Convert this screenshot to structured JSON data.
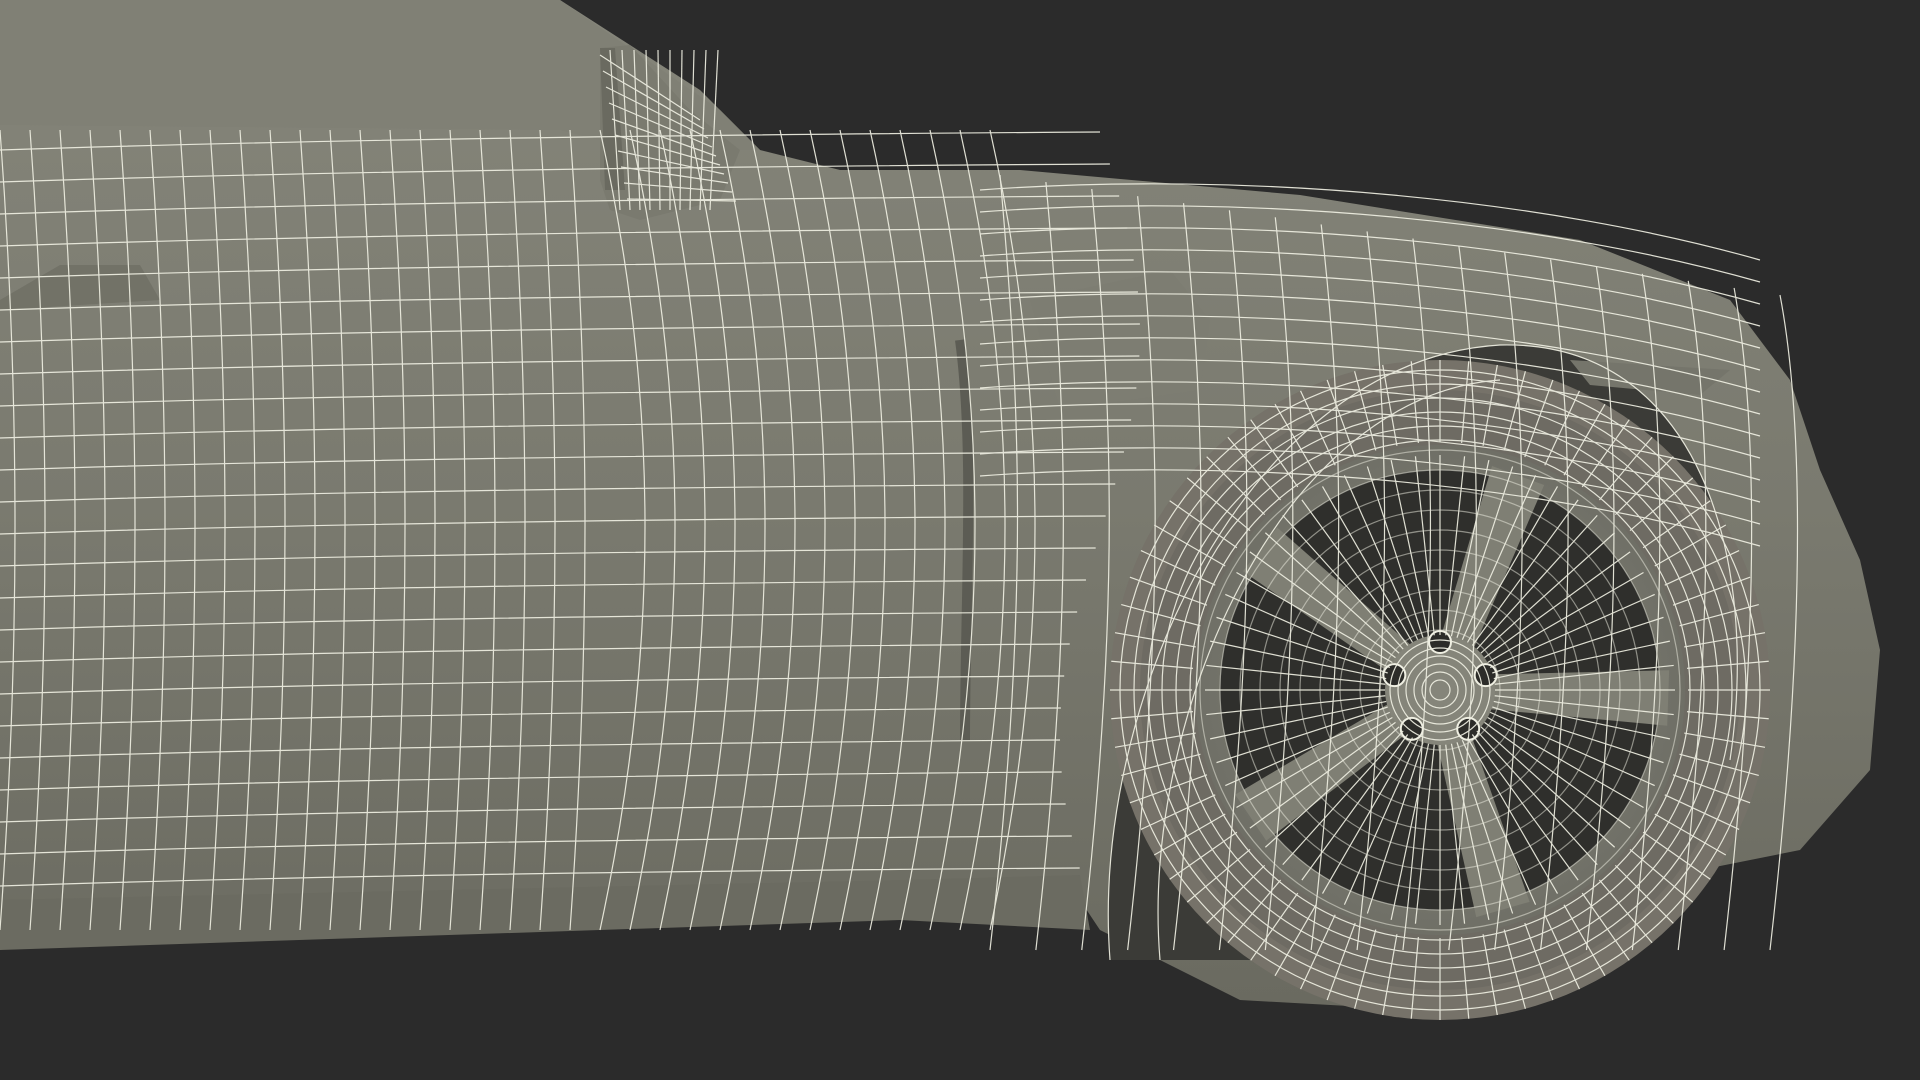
{
  "scene": {
    "background_color": "#2b2b2b",
    "body_color": "#7b7b70",
    "body_shadow_color": "#5e5e55",
    "wire_color": "#efefe2",
    "cavity_color": "#3a3a36",
    "subject": "car-front-quarter-wireframe"
  }
}
